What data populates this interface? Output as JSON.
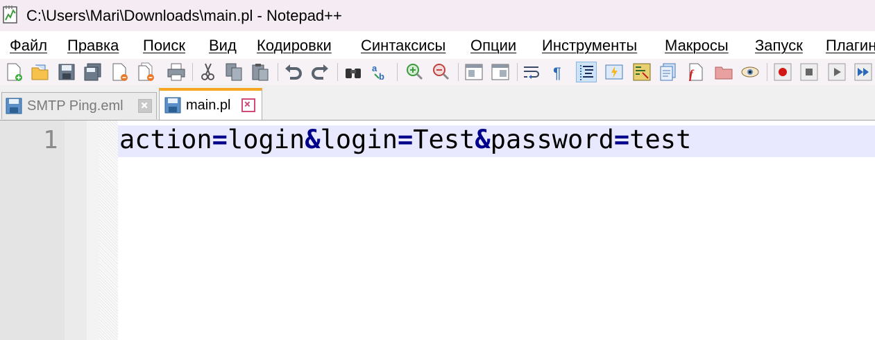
{
  "window": {
    "title": "C:\\Users\\Mari\\Downloads\\main.pl - Notepad++"
  },
  "menu": {
    "items": [
      "Файл",
      "Правка",
      "Поиск",
      "Вид",
      "Кодировки",
      "Синтаксисы",
      "Опции",
      "Инструменты",
      "Макросы",
      "Запуск",
      "Плагины"
    ]
  },
  "toolbar": {
    "icons": [
      "new-file-icon",
      "open-file-icon",
      "save-icon",
      "save-all-icon",
      "close-icon",
      "close-all-icon",
      "print-icon",
      "cut-icon",
      "copy-icon",
      "paste-icon",
      "undo-icon",
      "redo-icon",
      "find-icon",
      "replace-icon",
      "zoom-in-icon",
      "zoom-out-icon",
      "sync-vertical-icon",
      "sync-horizontal-icon",
      "word-wrap-icon",
      "show-all-characters-icon",
      "indent-guide-icon",
      "user-defined-language-icon",
      "document-map-icon",
      "document-list-icon",
      "function-list-icon",
      "folder-as-workspace-icon",
      "monitoring-icon",
      "record-macro-icon",
      "stop-record-icon",
      "playback-macro-icon",
      "run-macro-multiple-icon"
    ]
  },
  "tabs": [
    {
      "label": "SMTP Ping.eml",
      "active": false
    },
    {
      "label": "main.pl",
      "active": true
    }
  ],
  "editor": {
    "line_numbers": [
      "1"
    ],
    "lines": [
      {
        "tokens": [
          {
            "text": "action",
            "type": "ident"
          },
          {
            "text": "=",
            "type": "op"
          },
          {
            "text": "login",
            "type": "ident"
          },
          {
            "text": "&",
            "type": "op"
          },
          {
            "text": "login",
            "type": "ident"
          },
          {
            "text": "=",
            "type": "op"
          },
          {
            "text": "Test",
            "type": "ident"
          },
          {
            "text": "&",
            "type": "op"
          },
          {
            "text": "password",
            "type": "ident"
          },
          {
            "text": "=",
            "type": "op"
          },
          {
            "text": "test",
            "type": "ident"
          }
        ]
      }
    ]
  },
  "colors": {
    "operator": "#00008b",
    "current_line": "#e8e8ff",
    "active_tab_accent": "#f5a623"
  }
}
